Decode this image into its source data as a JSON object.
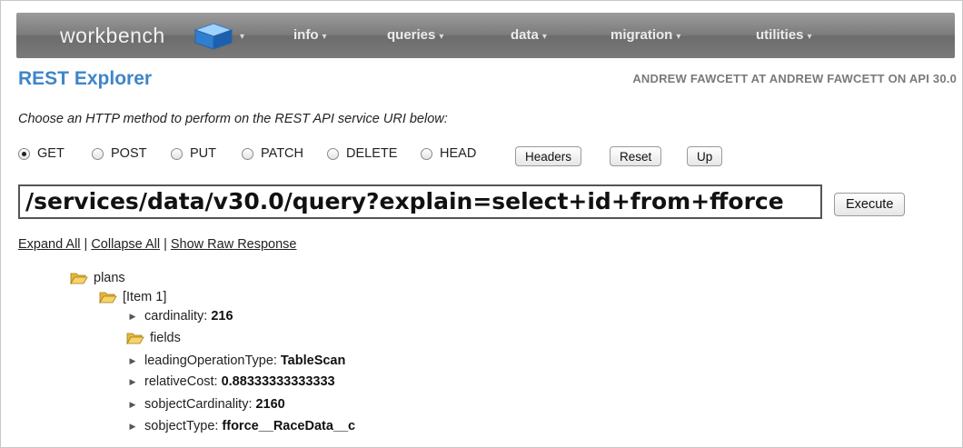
{
  "header": {
    "logo_text": "workbench",
    "nav": [
      {
        "label": "info"
      },
      {
        "label": "queries"
      },
      {
        "label": "data"
      },
      {
        "label": "migration"
      },
      {
        "label": "utilities"
      }
    ]
  },
  "page": {
    "title": "REST Explorer",
    "user_info": "ANDREW FAWCETT AT ANDREW FAWCETT ON API 30.0",
    "instructions": "Choose an HTTP method to perform on the REST API service URI below:"
  },
  "methods": {
    "options": [
      "GET",
      "POST",
      "PUT",
      "PATCH",
      "DELETE",
      "HEAD"
    ],
    "selected": "GET"
  },
  "buttons": {
    "headers": "Headers",
    "reset": "Reset",
    "up": "Up",
    "execute": "Execute"
  },
  "uri": {
    "value": "/services/data/v30.0/query?explain=select+id+from+fforce"
  },
  "links": {
    "expand_all": "Expand All",
    "collapse_all": "Collapse All",
    "show_raw": "Show Raw Response",
    "separator": "|"
  },
  "tree": {
    "root": "plans",
    "item": "[Item 1]",
    "cardinality": {
      "key": "cardinality:",
      "value": "216"
    },
    "fields": "fields",
    "leadingOperationType": {
      "key": "leadingOperationType:",
      "value": "TableScan"
    },
    "relativeCost": {
      "key": "relativeCost:",
      "value": "0.88333333333333"
    },
    "sobjectCardinality": {
      "key": "sobjectCardinality:",
      "value": "2160"
    },
    "sobjectType": {
      "key": "sobjectType:",
      "value": "fforce__RaceData__c"
    }
  }
}
